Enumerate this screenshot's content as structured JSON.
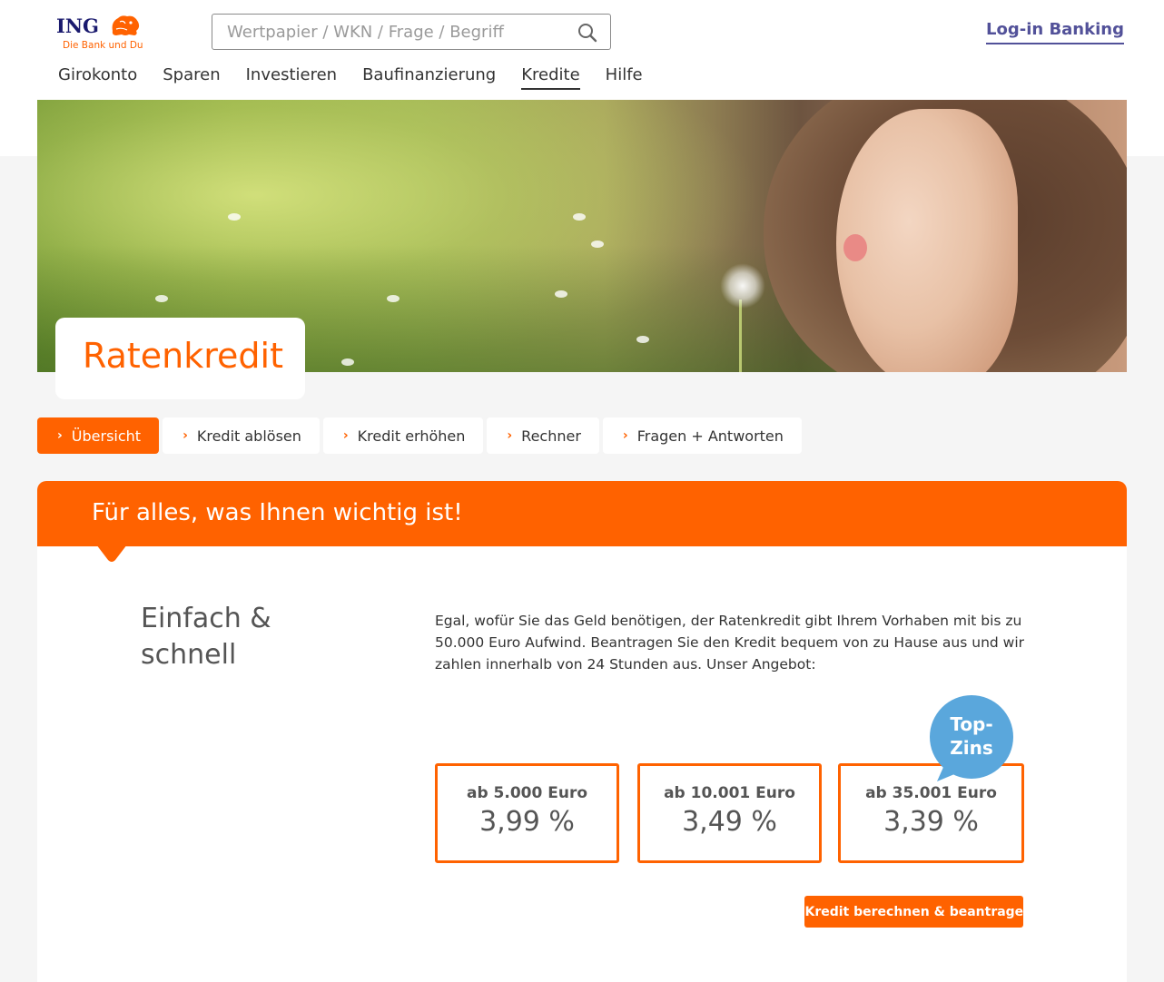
{
  "header": {
    "logo_text": "ING",
    "logo_tagline": "Die Bank und Du",
    "search_placeholder": "Wertpapier / WKN / Frage / Begriff",
    "login_label": "Log-in Banking"
  },
  "nav": {
    "items": [
      {
        "label": "Girokonto",
        "active": false
      },
      {
        "label": "Sparen",
        "active": false
      },
      {
        "label": "Investieren",
        "active": false
      },
      {
        "label": "Baufinanzierung",
        "active": false
      },
      {
        "label": "Kredite",
        "active": true
      },
      {
        "label": "Hilfe",
        "active": false
      }
    ]
  },
  "hero": {
    "title": "Ratenkredit"
  },
  "subnav": {
    "tabs": [
      {
        "label": "Übersicht",
        "active": true
      },
      {
        "label": "Kredit ablösen",
        "active": false
      },
      {
        "label": "Kredit erhöhen",
        "active": false
      },
      {
        "label": "Rechner",
        "active": false
      },
      {
        "label": "Fragen + Antworten",
        "active": false
      }
    ]
  },
  "content": {
    "banner_title": "Für alles, was Ihnen wichtig ist!",
    "section_title_line1": "Einfach &",
    "section_title_line2": "schnell",
    "intro": "Egal, wofür Sie das Geld benötigen, der Ratenkredit gibt Ihrem Vorhaben mit bis zu 50.000 Euro Aufwind. Beantragen Sie den Kredit bequem von zu Hause aus und wir zahlen innerhalb von 24 Stunden aus. Unser Angebot:",
    "rates": [
      {
        "amount": "ab 5.000 Euro",
        "rate": "3,99 %"
      },
      {
        "amount": "ab 10.001 Euro",
        "rate": "3,49 %"
      },
      {
        "amount": "ab 35.001 Euro",
        "rate": "3,39 %"
      }
    ],
    "badge_line1": "Top-",
    "badge_line2": "Zins",
    "cta_label": "› Kredit berechnen & beantragen"
  },
  "colors": {
    "brand_orange": "#ff6200",
    "brand_navy": "#1a1a6e",
    "login_purple": "#525199",
    "badge_blue": "#5aa7dc"
  }
}
